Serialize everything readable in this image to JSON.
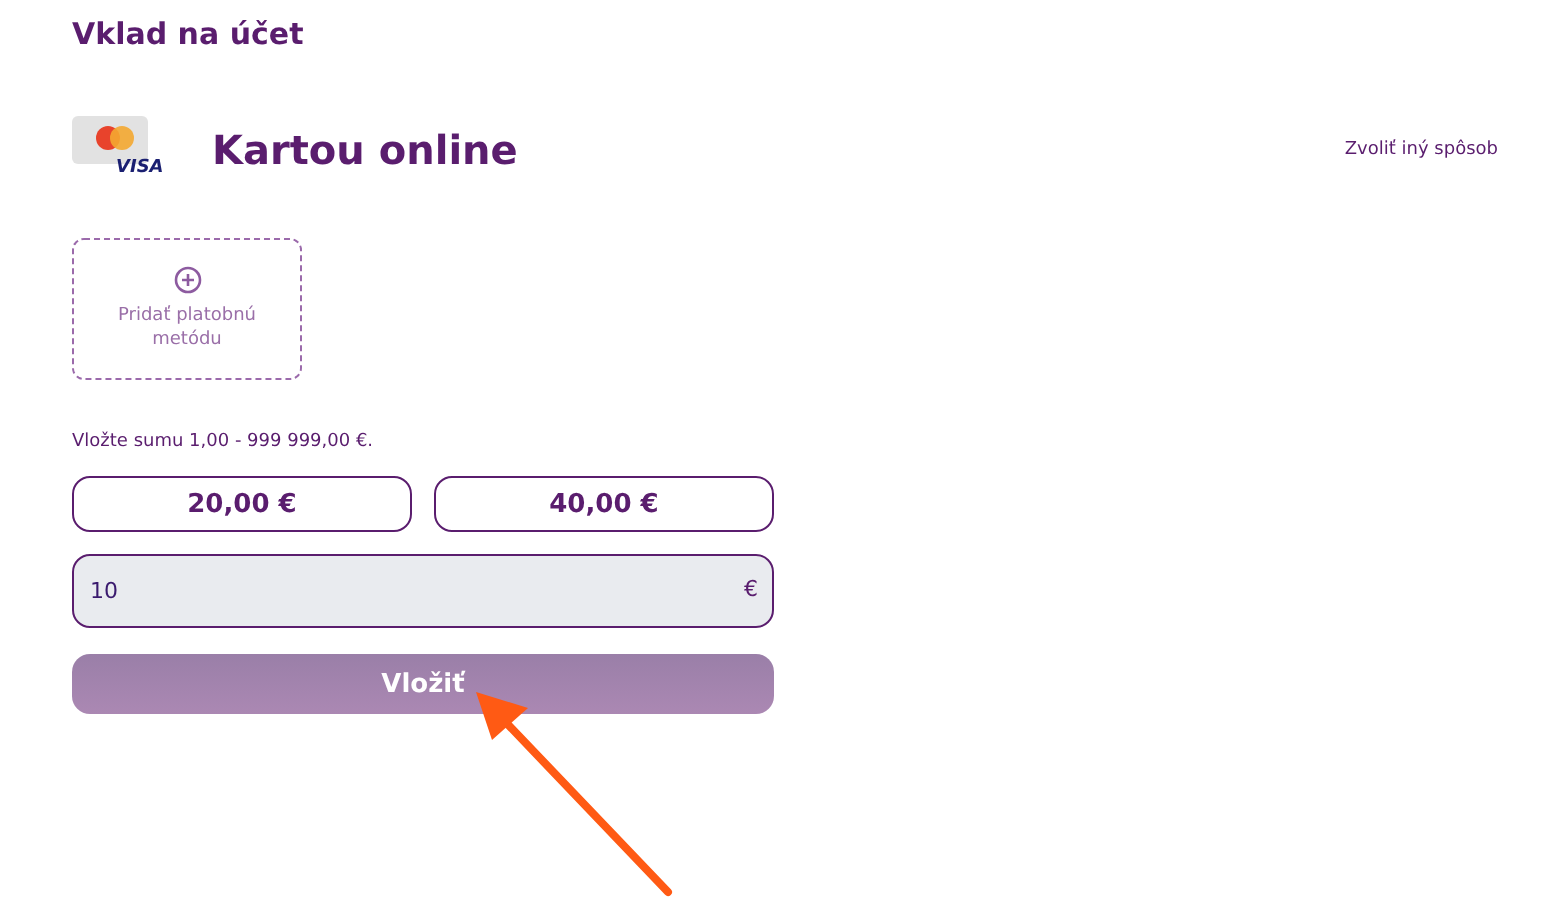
{
  "title": "Vklad na účet",
  "method": {
    "card_brand": "VISA",
    "name": "Kartou online",
    "change_link": "Zvoliť iný spôsob"
  },
  "add_method": {
    "label": "Pridať platobnú metódu"
  },
  "hint": "Vložte sumu 1,00 - 999 999,00 €.",
  "quick_amounts": [
    "20,00 €",
    "40,00 €"
  ],
  "amount": {
    "value": "10",
    "currency": "€"
  },
  "submit": {
    "label": "Vložiť",
    "disabled": true
  }
}
